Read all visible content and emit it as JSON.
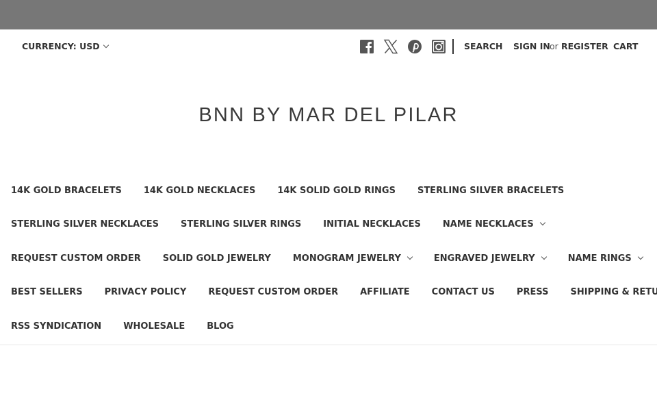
{
  "utility": {
    "currency_label": "CURRENCY: USD",
    "social_icons": [
      "facebook-icon",
      "x-icon",
      "pinterest-icon",
      "instagram-icon"
    ],
    "search_label": "SEARCH",
    "sign_in_label": "SIGN IN",
    "or_text": "or",
    "register_label": "REGISTER",
    "cart_label": "CART"
  },
  "store_name": "BNN BY MAR DEL PILAR",
  "nav": {
    "rows": [
      [
        {
          "label": "14K GOLD BRACELETS",
          "dropdown": false
        },
        {
          "label": "14K GOLD NECKLACES",
          "dropdown": false
        },
        {
          "label": "14K SOLID GOLD RINGS",
          "dropdown": false
        },
        {
          "label": "STERLING SILVER BRACELETS",
          "dropdown": false
        }
      ],
      [
        {
          "label": "STERLING SILVER NECKLACES",
          "dropdown": false
        },
        {
          "label": "STERLING SILVER RINGS",
          "dropdown": false
        },
        {
          "label": "INITIAL NECKLACES",
          "dropdown": false
        },
        {
          "label": "NAME NECKLACES",
          "dropdown": true
        }
      ],
      [
        {
          "label": "REQUEST CUSTOM ORDER",
          "dropdown": false
        },
        {
          "label": "SOLID GOLD JEWELRY",
          "dropdown": false
        },
        {
          "label": "MONOGRAM JEWELRY",
          "dropdown": true
        },
        {
          "label": "ENGRAVED JEWELRY",
          "dropdown": true
        },
        {
          "label": "NAME RINGS",
          "dropdown": true
        }
      ],
      [
        {
          "label": "BEST SELLERS",
          "dropdown": false
        },
        {
          "label": "PRIVACY POLICY",
          "dropdown": false
        },
        {
          "label": "REQUEST CUSTOM ORDER",
          "dropdown": false
        },
        {
          "label": "AFFILIATE",
          "dropdown": false
        },
        {
          "label": "CONTACT US",
          "dropdown": false
        },
        {
          "label": "PRESS",
          "dropdown": false
        },
        {
          "label": "SHIPPING & RETURNS",
          "dropdown": false
        }
      ],
      [
        {
          "label": "RSS SYNDICATION",
          "dropdown": false
        },
        {
          "label": "WHOLESALE",
          "dropdown": false
        },
        {
          "label": "BLOG",
          "dropdown": false
        }
      ]
    ]
  },
  "colors": {
    "banner": "#777777",
    "text": "#333333"
  }
}
